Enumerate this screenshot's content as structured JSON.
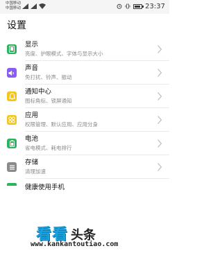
{
  "status_bar": {
    "carrier_1": "中国移动",
    "carrier_2": "中国移动",
    "time": "23:37",
    "battery_level": 0.9
  },
  "page": {
    "title": "设置"
  },
  "settings": [
    {
      "label": "显示",
      "subtitle": "亮度、护眼模式、字体与显示大小",
      "icon": "display-icon",
      "color": "#2ab55c"
    },
    {
      "label": "声音",
      "subtitle": "免打扰、铃声、振动",
      "icon": "sound-icon",
      "color": "#8a5cf5"
    },
    {
      "label": "通知中心",
      "subtitle": "图标角标、锁屏通知",
      "icon": "notification-icon",
      "color": "#f5c518"
    },
    {
      "label": "应用",
      "subtitle": "权限管理、默认应用、应用分身",
      "icon": "apps-icon",
      "color": "#f5c518"
    },
    {
      "label": "电池",
      "subtitle": "省电模式、耗电排行",
      "icon": "battery-icon",
      "color": "#2ab55c"
    },
    {
      "label": "存储",
      "subtitle": "清理加速",
      "icon": "storage-icon",
      "color": "#8a8a8a"
    }
  ],
  "partial_item": {
    "label": "健康使用手机"
  },
  "watermark": {
    "main": "看看",
    "sub": "头条",
    "url": "www.kankantoutiao.com"
  }
}
